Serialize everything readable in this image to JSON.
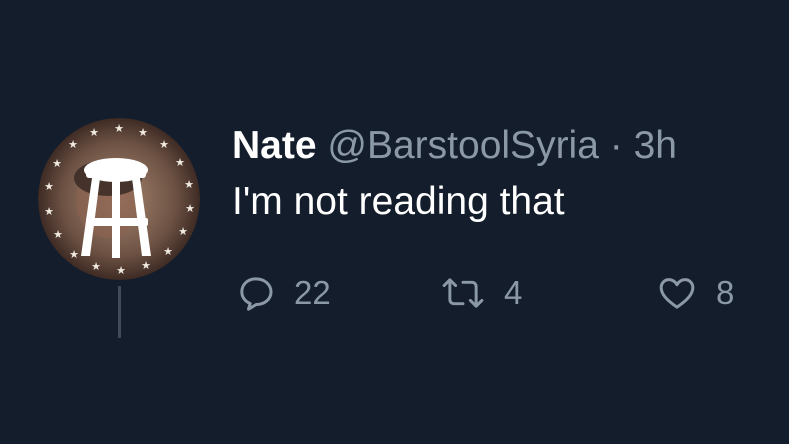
{
  "tweet": {
    "author_name": "Nate",
    "author_handle": "@BarstoolSyria",
    "separator": "·",
    "time": "3h",
    "text": "I'm not reading that",
    "avatar_icon": "barstool-logo-avatar"
  },
  "actions": {
    "reply": {
      "icon": "reply-icon",
      "count": "22"
    },
    "retweet": {
      "icon": "retweet-icon",
      "count": "4"
    },
    "like": {
      "icon": "heart-icon",
      "count": "8"
    }
  },
  "colors": {
    "background": "#141d2b",
    "primary_text": "#ffffff",
    "secondary_text": "#8b98a5",
    "thread_line": "#3f4a5a"
  }
}
